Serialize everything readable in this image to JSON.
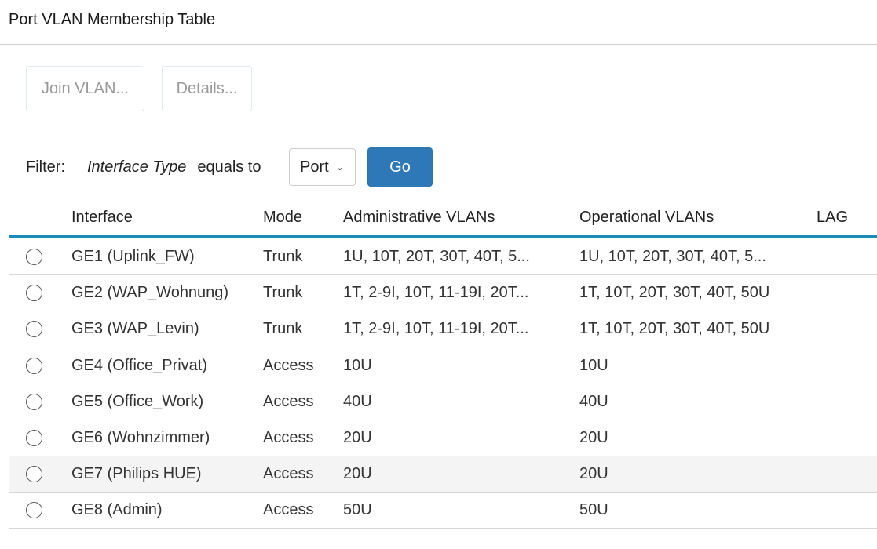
{
  "title": "Port VLAN Membership Table",
  "toolbar": {
    "join_vlan": "Join VLAN...",
    "details": "Details..."
  },
  "filter": {
    "label": "Filter:",
    "field": "Interface Type",
    "operator": "equals to",
    "value": "Port",
    "go": "Go"
  },
  "colors": {
    "accent": "#1a8cbc",
    "go_button": "#2f78b8"
  },
  "table": {
    "headers": [
      "Interface",
      "Mode",
      "Administrative VLANs",
      "Operational VLANs",
      "LAG"
    ],
    "rows": [
      {
        "interface": "GE1 (Uplink_FW)",
        "mode": "Trunk",
        "admin": "1U, 10T, 20T, 30T, 40T, 5...",
        "oper": "1U, 10T, 20T, 30T, 40T, 5...",
        "lag": ""
      },
      {
        "interface": "GE2 (WAP_Wohnung)",
        "mode": "Trunk",
        "admin": "1T, 2-9I, 10T, 11-19I, 20T...",
        "oper": "1T, 10T, 20T, 30T, 40T, 50U",
        "lag": ""
      },
      {
        "interface": "GE3 (WAP_Levin)",
        "mode": "Trunk",
        "admin": "1T, 2-9I, 10T, 11-19I, 20T...",
        "oper": "1T, 10T, 20T, 30T, 40T, 50U",
        "lag": ""
      },
      {
        "interface": "GE4 (Office_Privat)",
        "mode": "Access",
        "admin": "10U",
        "oper": "10U",
        "lag": ""
      },
      {
        "interface": "GE5 (Office_Work)",
        "mode": "Access",
        "admin": "40U",
        "oper": "40U",
        "lag": ""
      },
      {
        "interface": "GE6 (Wohnzimmer)",
        "mode": "Access",
        "admin": "20U",
        "oper": "20U",
        "lag": ""
      },
      {
        "interface": "GE7 (Philips HUE)",
        "mode": "Access",
        "admin": "20U",
        "oper": "20U",
        "lag": ""
      },
      {
        "interface": "GE8 (Admin)",
        "mode": "Access",
        "admin": "50U",
        "oper": "50U",
        "lag": ""
      }
    ]
  }
}
